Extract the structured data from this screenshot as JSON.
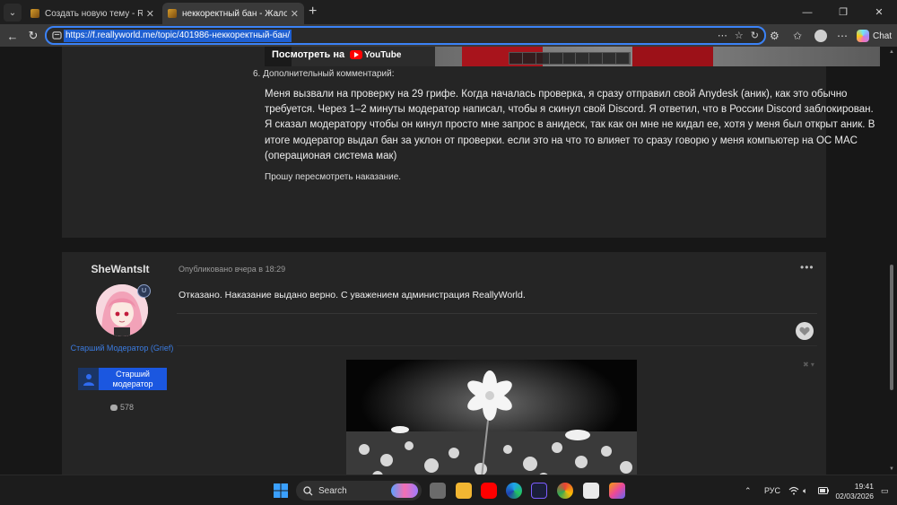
{
  "browser": {
    "tabs": [
      {
        "title": "Создать новую тему - ReallyWorld",
        "active": false
      },
      {
        "title": "неккоректный бан - Жалобы на а",
        "active": true
      }
    ],
    "url": "https://f.reallyworld.me/topic/401986-неккоректный-бан/",
    "copilot_label": "Chat"
  },
  "post1": {
    "video_watch_label": "Посмотреть на",
    "youtube_label": "YouTube",
    "item6_label": "6.  Дополнительный комментарий:",
    "comment_text": "Меня вызвали на проверку на 29 грифе. Когда началась проверка, я сразу отправил свой Anydesk (аник), как это обычно требуется. Через 1–2 минуты модератор написал, чтобы я скинул свой Discord. Я ответил, что в России Discord заблокирован. Я сказал модератору чтобы он кинул просто мне запрос в анидеск, так как он мне не кидал ее, хотя у меня был открыт аник. В итоге модератор выдал бан за уклон от проверки. если это на что то влияет то сразу говорю у меня компьютер на ОС MAC (операционая система мак)",
    "appeal_text": "Прошу пересмотреть наказание."
  },
  "post2": {
    "author_name": "SheWantsIt",
    "role": "Старший Модератор (Grief)",
    "rank_label": "Старший модератор",
    "post_count": "578",
    "meta": "Опубликовано вчера в 18:29",
    "menu": "•••",
    "reply_text": "Отказано. Наказание выдано верно. С уважением администрация ReallyWorld."
  },
  "taskbar": {
    "search_label": "Search",
    "language": "РУС",
    "time": "19:41",
    "date": "02/03/2026"
  },
  "colors": {
    "accent": "#3b82f6",
    "role_color": "#3b7be0",
    "rank_bg": "#1b57e0",
    "post_bg": "#252525",
    "page_bg": "#171717"
  }
}
